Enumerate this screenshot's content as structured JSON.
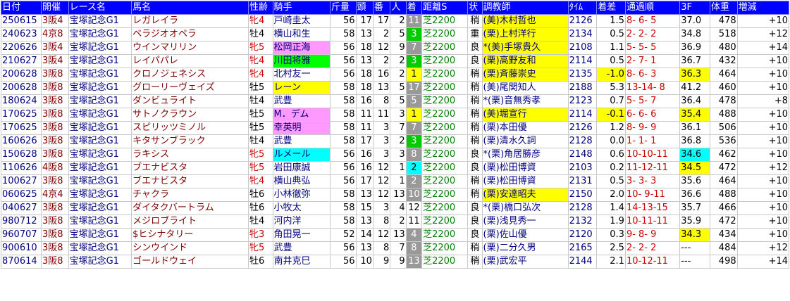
{
  "headers": [
    "日付",
    "開催",
    "レース名",
    "馬名",
    "性齢",
    "騎手",
    "斤量",
    "頭",
    "番",
    "人",
    "着",
    "距離S",
    "状",
    "調教師",
    "ﾀｲﾑ",
    "着差",
    "通過順",
    "3F",
    "体重",
    "増減"
  ],
  "rows": [
    {
      "date": "250615",
      "venue": "3阪4",
      "race": "宝塚記念G1",
      "horse": "レガレイラ",
      "sex": "牝4",
      "jockey": "戸崎圭太",
      "kinryo": "56",
      "heads": "17",
      "num": "17",
      "pop": "2",
      "rank": "11",
      "dist": "芝2200",
      "cond": "稍",
      "trainer": "(美)木村哲也",
      "time": "2126",
      "margin": "1.5",
      "pass": "8- 6- 5",
      "f3": "37.0",
      "weight": "478",
      "diff": "+10"
    },
    {
      "date": "240623",
      "venue": "4京8",
      "race": "宝塚記念G1",
      "horse": "ベラジオオペラ",
      "sex": "牡4",
      "jockey": "横山和生",
      "kinryo": "58",
      "heads": "13",
      "num": "2",
      "pop": "5",
      "rank": "3",
      "dist": "芝2200",
      "cond": "重",
      "trainer": "(栗)上村洋行",
      "time": "2134",
      "margin": "0.5",
      "pass": "2- 2- 2",
      "f3": "34.8",
      "weight": "518",
      "diff": "+12"
    },
    {
      "date": "220626",
      "venue": "3阪4",
      "race": "宝塚記念G1",
      "horse": "ウインマリリン",
      "sex": "牝5",
      "jockey": "松岡正海",
      "kinryo": "56",
      "heads": "18",
      "num": "12",
      "pop": "9",
      "rank": "7",
      "dist": "芝2200",
      "cond": "良",
      "trainer": "*(美)手塚貴久",
      "time": "2108",
      "margin": "1.1",
      "pass": "5- 5- 5",
      "f3": "36.9",
      "weight": "480",
      "diff": "+14"
    },
    {
      "date": "210627",
      "venue": "3阪4",
      "race": "宝塚記念G1",
      "horse": "レイパパレ",
      "sex": "牝4",
      "jockey": "川田将雅",
      "kinryo": "56",
      "heads": "13",
      "num": "2",
      "pop": "2",
      "rank": "3",
      "dist": "芝2200",
      "cond": "良",
      "trainer": "(栗)高野友和",
      "time": "2114",
      "margin": "0.5",
      "pass": "2- 7- 1",
      "f3": "36.7",
      "weight": "432",
      "diff": "+10"
    },
    {
      "date": "200628",
      "venue": "3阪8",
      "race": "宝塚記念G1",
      "horse": "クロノジェネシス",
      "sex": "牝4",
      "jockey": "北村友一",
      "kinryo": "56",
      "heads": "18",
      "num": "16",
      "pop": "2",
      "rank": "1",
      "dist": "芝2200",
      "cond": "稍",
      "trainer": "(栗)斉藤崇史",
      "time": "2135",
      "margin": "-1.0",
      "pass": "8- 6- 3",
      "f3": "36.3",
      "weight": "464",
      "diff": "+10"
    },
    {
      "date": "200628",
      "venue": "3阪8",
      "race": "宝塚記念G1",
      "horse": "グローリーヴェイズ",
      "sex": "牡5",
      "jockey": "レーン",
      "kinryo": "58",
      "heads": "18",
      "num": "13",
      "pop": "5",
      "rank": "17",
      "dist": "芝2200",
      "cond": "稍",
      "trainer": "(美)尾関知人",
      "time": "2188",
      "margin": "5.3",
      "pass": "13-14- 8",
      "f3": "41.2",
      "weight": "460",
      "diff": "+10"
    },
    {
      "date": "180624",
      "venue": "3阪8",
      "race": "宝塚記念G1",
      "horse": "ダンビュライト",
      "sex": "牡4",
      "jockey": "武豊",
      "kinryo": "58",
      "heads": "16",
      "num": "8",
      "pop": "5",
      "rank": "5",
      "dist": "芝2200",
      "cond": "稍",
      "trainer": "*(栗)音無秀孝",
      "time": "2123",
      "margin": "0.7",
      "pass": "5- 5- 7",
      "f3": "36.4",
      "weight": "478",
      "diff": "+8"
    },
    {
      "date": "170625",
      "venue": "3阪8",
      "race": "宝塚記念G1",
      "horse": "サトノクラウン",
      "sex": "牡5",
      "jockey": "M．デム",
      "kinryo": "58",
      "heads": "11",
      "num": "11",
      "pop": "3",
      "rank": "1",
      "dist": "芝2200",
      "cond": "稍",
      "trainer": "(美)堀宣行",
      "time": "2114",
      "margin": "-0.1",
      "pass": "6- 6- 6",
      "f3": "35.4",
      "weight": "488",
      "diff": "+10"
    },
    {
      "date": "170625",
      "venue": "3阪8",
      "race": "宝塚記念G1",
      "horse": "スピリッツミノル",
      "sex": "牡5",
      "jockey": "幸英明",
      "kinryo": "58",
      "heads": "11",
      "num": "3",
      "pop": "7",
      "rank": "7",
      "dist": "芝2200",
      "cond": "稍",
      "trainer": "(栗)本田優",
      "time": "2126",
      "margin": "1.2",
      "pass": "8- 9- 9",
      "f3": "36.1",
      "weight": "506",
      "diff": "+10"
    },
    {
      "date": "160626",
      "venue": "3阪8",
      "race": "宝塚記念G1",
      "horse": "キタサンブラック",
      "sex": "牡4",
      "jockey": "武豊",
      "kinryo": "58",
      "heads": "17",
      "num": "3",
      "pop": "2",
      "rank": "3",
      "dist": "芝2200",
      "cond": "稍",
      "trainer": "(栗)清水久詞",
      "time": "2128",
      "margin": "0.0",
      "pass": "1- 1- 1",
      "f3": "36.8",
      "weight": "536",
      "diff": "+10"
    },
    {
      "date": "150628",
      "venue": "3阪8",
      "race": "宝塚記念G1",
      "horse": "ラキシス",
      "sex": "牝5",
      "jockey": "ルメール",
      "kinryo": "56",
      "heads": "16",
      "num": "3",
      "pop": "3",
      "rank": "8",
      "dist": "芝2200",
      "cond": "良",
      "trainer": "*(栗)角居勝彦",
      "time": "2148",
      "margin": "0.6",
      "pass": "10-10-11",
      "f3": "34.6",
      "weight": "462",
      "diff": "+10"
    },
    {
      "date": "110626",
      "venue": "4阪8",
      "race": "宝塚記念G1",
      "horse": "ブエナビスタ",
      "sex": "牝5",
      "jockey": "岩田康誠",
      "kinryo": "56",
      "heads": "16",
      "num": "12",
      "pop": "1",
      "rank": "2",
      "dist": "芝2200",
      "cond": "良",
      "trainer": "(栗)松田博資",
      "time": "2103",
      "margin": "0.2",
      "pass": "11-12-11",
      "f3": "34.5",
      "weight": "472",
      "diff": "+12"
    },
    {
      "date": "100627",
      "venue": "3阪8",
      "race": "宝塚記念G1",
      "horse": "ブエナビスタ",
      "sex": "牝4",
      "jockey": "横山典弘",
      "kinryo": "56",
      "heads": "17",
      "num": "12",
      "pop": "1",
      "rank": "2",
      "dist": "芝2200",
      "cond": "稍",
      "trainer": "(栗)松田博資",
      "time": "2131",
      "margin": "0.5",
      "pass": "3- 3- 3",
      "f3": "35.6",
      "weight": "464",
      "diff": "+10"
    },
    {
      "date": "060625",
      "venue": "4京4",
      "race": "宝塚記念G1",
      "horse": "チャクラ",
      "sex": "牡6",
      "jockey": "小林徹弥",
      "kinryo": "58",
      "heads": "13",
      "num": "12",
      "pop": "13",
      "rank": "10",
      "dist": "芝2200",
      "cond": "稍",
      "trainer": "(栗)安達昭夫",
      "time": "2150",
      "margin": "2.0",
      "pass": "10- 9-11",
      "f3": "36.6",
      "weight": "488",
      "diff": "+10"
    },
    {
      "date": "040627",
      "venue": "3阪8",
      "race": "宝塚記念G1",
      "horse": "ダイタクバートラム",
      "sex": "牡6",
      "jockey": "小牧太",
      "kinryo": "58",
      "heads": "15",
      "num": "3",
      "pop": "4",
      "rank": "12",
      "dist": "芝2200",
      "cond": "良",
      "trainer": "*(栗)橋口弘次",
      "time": "2128",
      "margin": "1.4",
      "pass": "14-13-15",
      "f3": "35.7",
      "weight": "466",
      "diff": "+10"
    },
    {
      "date": "980712",
      "venue": "3阪8",
      "race": "宝塚記念G1",
      "horse": "メジロブライト",
      "sex": "牡4",
      "jockey": "河内洋",
      "kinryo": "58",
      "heads": "13",
      "num": "8",
      "pop": "2",
      "rank": "11",
      "dist": "芝2200",
      "cond": "良",
      "trainer": "(栗)浅見秀一",
      "time": "2132",
      "margin": "1.9",
      "pass": "10-11-11",
      "f3": "35.9",
      "weight": "472",
      "diff": "+10"
    },
    {
      "date": "960707",
      "venue": "3阪8",
      "race": "宝塚記念G1",
      "horse": "$ヒシナタリー",
      "sex": "牝3",
      "jockey": "角田晃一",
      "kinryo": "52",
      "heads": "14",
      "num": "12",
      "pop": "13",
      "rank": "4",
      "dist": "芝2200",
      "cond": "良",
      "trainer": "(栗)佐山優",
      "time": "2120",
      "margin": "0.3",
      "pass": "9- 8- 9",
      "f3": "34.3",
      "weight": "434",
      "diff": "+10"
    },
    {
      "date": "900610",
      "venue": "3阪8",
      "race": "宝塚記念G1",
      "horse": "シンウインド",
      "sex": "牝5",
      "jockey": "武豊",
      "kinryo": "56",
      "heads": "13",
      "num": "8",
      "pop": "7",
      "rank": "8",
      "dist": "芝2200",
      "cond": "稍",
      "trainer": "(栗)二分久男",
      "time": "2165",
      "margin": "2.5",
      "pass": "2- 2- 2",
      "f3": "---",
      "weight": "484",
      "diff": "+12"
    },
    {
      "date": "870614",
      "venue": "3阪8",
      "race": "宝塚記念G1",
      "horse": "ゴールドウェイ",
      "sex": "牡6",
      "jockey": "南井克巳",
      "kinryo": "56",
      "heads": "10",
      "num": "9",
      "pop": "9",
      "rank": "13",
      "dist": "芝2200",
      "cond": "稍",
      "trainer": "(栗)武宏平",
      "time": "2144",
      "margin": "2.1",
      "pass": "10-12-11",
      "f3": "---",
      "weight": "498",
      "diff": "+14"
    }
  ],
  "highlights": {
    "jockey": {
      "2": "violet",
      "3": "lime",
      "5": "yellow",
      "7": "violet",
      "8": "violet",
      "10": "cyan"
    },
    "rank": {
      "0": "gray",
      "1": "green",
      "2": "gray",
      "3": "green",
      "4": "yellow",
      "5": "gray",
      "6": "gray",
      "7": "yellow",
      "8": "gray",
      "9": "green",
      "10": "gray",
      "11": "cyan",
      "12": "gray",
      "13": "gray",
      "14": "plain",
      "15": "plain",
      "16": "gray",
      "17": "gray",
      "18": "gray"
    },
    "trainer": {
      "0": "yellow",
      "1": "yellow",
      "2": "yellow",
      "3": "yellow",
      "4": "yellow",
      "7": "yellow",
      "13": "yellow"
    },
    "margin": {
      "4": "yellow",
      "7": "yellow"
    },
    "f3": {
      "4": "yellow",
      "7": "yellow",
      "10": "cyan",
      "11": "yellow",
      "16": "yellow"
    }
  },
  "colors": {
    "header_bg": "#0000ff",
    "header_text": "#ffffff",
    "lime": "#00ff00",
    "yellow": "#ffff00",
    "violet": "#ff99ff",
    "cyan": "#00ffff",
    "green": "#00cc00",
    "gray": "#999999"
  }
}
